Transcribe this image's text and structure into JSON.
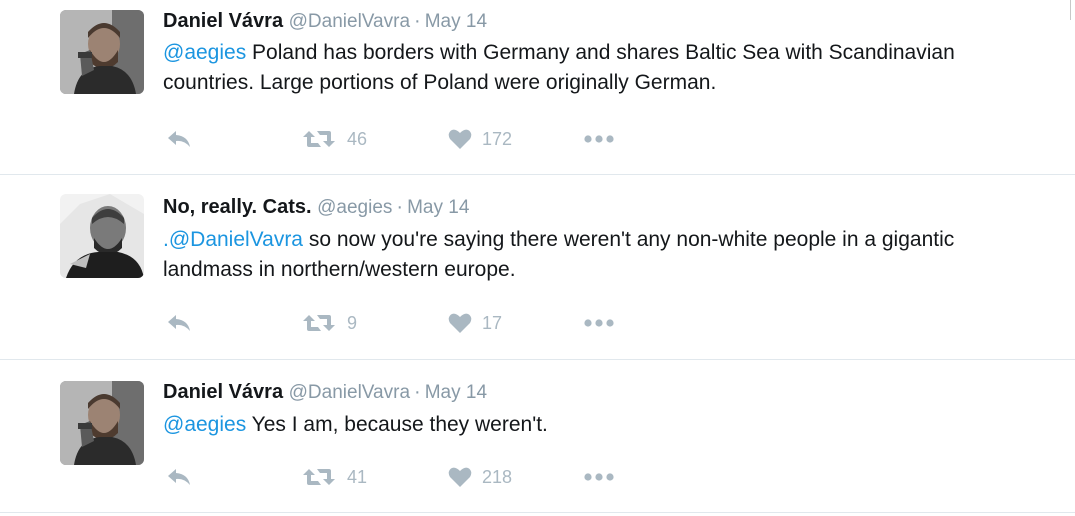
{
  "tweets": [
    {
      "fullname": "Daniel Vávra",
      "screenname": "@DanielVavra",
      "time": "May 14",
      "mention": "@aegies",
      "text": " Poland has borders with Germany and shares Baltic Sea with Scandinavian countries. Large portions of Poland were originally German.",
      "retweets": "46",
      "likes": "172"
    },
    {
      "fullname": "No, really. Cats.",
      "screenname": "@aegies",
      "time": "May 14",
      "mention": ".@DanielVavra",
      "text": " so now you're saying there weren't any non-white people in a gigantic landmass in northern/western europe.",
      "retweets": "9",
      "likes": "17"
    },
    {
      "fullname": "Daniel Vávra",
      "screenname": "@DanielVavra",
      "time": "May 14",
      "mention": "@aegies",
      "text": " Yes I am, because they weren't.",
      "retweets": "41",
      "likes": "218"
    }
  ],
  "separator": "·",
  "icons": {
    "reply": "reply-icon",
    "retweet": "retweet-icon",
    "like": "heart-icon",
    "more": "more-options-icon"
  },
  "colors": {
    "link": "#1b95e0",
    "muted": "#8899a6",
    "action": "#aab8c2",
    "divider": "#e1e8ed"
  }
}
